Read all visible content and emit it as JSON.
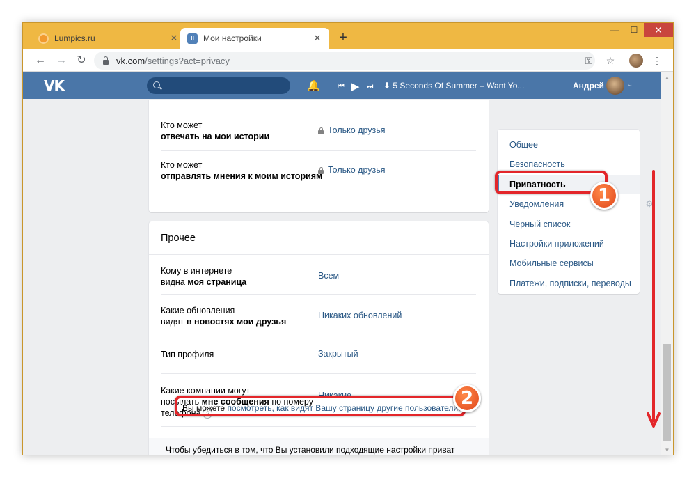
{
  "browser": {
    "tabs": [
      {
        "label": "Lumpics.ru",
        "close": "✕"
      },
      {
        "label": "Мои настройки",
        "close": "✕"
      }
    ],
    "new_tab": "+",
    "window_controls": {
      "minimize": "—",
      "maximize": "☐",
      "close": "✕"
    },
    "nav": {
      "back": "←",
      "forward": "→",
      "reload": "↻"
    },
    "url_host": "vk.com",
    "url_path": "/settings?act=privacy",
    "toolbar_icons": {
      "key": "⚿",
      "star": "☆",
      "menu": "⋮"
    }
  },
  "vk_header": {
    "logo": "VK",
    "track": "⬇ 5 Seconds Of Summer – Want Yo...",
    "user_name": "Андрей",
    "icons": {
      "bell": "🔔",
      "prev": "⏮",
      "play": "▶",
      "next": "⏭",
      "chevron": "⌄"
    }
  },
  "privacy_rows_top": [
    {
      "label_pre": "Кто может",
      "label_bold": "отвечать на мои истории",
      "value": "Только друзья"
    },
    {
      "label_pre": "Кто может",
      "label_bold": "отправлять мнения к моим историям",
      "value": "Только друзья"
    }
  ],
  "other_section": {
    "title": "Прочее",
    "rows": [
      {
        "label_pre": "Кому в интернете",
        "label_mid_pre": "видна ",
        "label_bold": "моя страница",
        "label_post": "",
        "value": "Всем"
      },
      {
        "label_pre": "Какие обновления",
        "label_mid_pre": "видят ",
        "label_bold": "в новостях мои друзья",
        "label_post": "",
        "value": "Никаких обновлений"
      },
      {
        "label_pre": "Тип профиля",
        "value": "Закрытый"
      },
      {
        "label_pre": "Какие компании могут",
        "label_mid_pre": "посылать ",
        "label_bold": "мне сообщения",
        "label_post": " по номеру",
        "label_last": "телефона",
        "qmark": "?",
        "value": "Никакие"
      }
    ],
    "footnote_line1": "Чтобы убедиться в том, что Вы установили подходящие настройки приватности,",
    "footnote_line2_pre": "Вы можете ",
    "footnote_line2_link": "посмотреть, как видят Вашу страницу другие пользователи."
  },
  "settings_menu": {
    "items": [
      {
        "label": "Общее"
      },
      {
        "label": "Безопасность"
      },
      {
        "label": "Приватность"
      },
      {
        "label": "Уведомления"
      },
      {
        "label": "Чёрный список"
      },
      {
        "label": "Настройки приложений"
      },
      {
        "label": "Мобильные сервисы"
      },
      {
        "label": "Платежи, подписки, переводы"
      }
    ],
    "selected_index": 2,
    "gear_icon": "⚙"
  },
  "annotations": {
    "badge1": "1",
    "badge2": "2",
    "highlight_color": "#e3262a",
    "badge_color": "#f0632a"
  },
  "colors": {
    "vk_header": "#4a76a8",
    "link": "#2a5885",
    "window_frame": "#efb843"
  }
}
